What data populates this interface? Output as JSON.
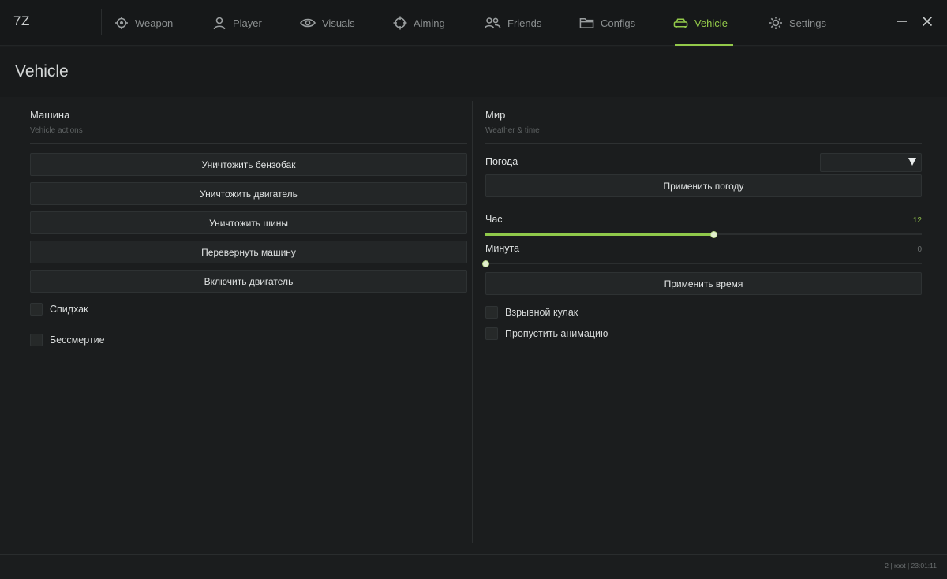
{
  "app": {
    "logo": "7Z"
  },
  "nav": {
    "tabs": [
      {
        "label": "Weapon",
        "icon": "crosshair-dot-icon"
      },
      {
        "label": "Player",
        "icon": "user-icon"
      },
      {
        "label": "Visuals",
        "icon": "eye-icon"
      },
      {
        "label": "Aiming",
        "icon": "target-icon"
      },
      {
        "label": "Friends",
        "icon": "users-icon"
      },
      {
        "label": "Configs",
        "icon": "folder-icon"
      },
      {
        "label": "Vehicle",
        "icon": "car-icon",
        "active": true
      },
      {
        "label": "Settings",
        "icon": "sun-gear-icon"
      }
    ],
    "accent_color": "#93c94a"
  },
  "page": {
    "title": "Vehicle"
  },
  "left_panel": {
    "title": "Машина",
    "subtitle": "Vehicle actions",
    "buttons": [
      "Уничтожить бензобак",
      "Уничтожить двигатель",
      "Уничтожить шины",
      "Перевернуть машину",
      "Включить двигатель"
    ],
    "checkboxes": [
      {
        "label": "Спидхак",
        "checked": false
      },
      {
        "label": "Бессмертие",
        "checked": false
      }
    ]
  },
  "right_panel": {
    "title": "Мир",
    "subtitle": "Weather & time",
    "weather": {
      "label": "Погода",
      "selected": ""
    },
    "apply_weather_label": "Применить погоду",
    "hour": {
      "label": "Час",
      "value": "12",
      "fraction": 0.522
    },
    "minute": {
      "label": "Минута",
      "value": "0",
      "fraction": 0.0
    },
    "apply_time_label": "Применить время",
    "checkboxes": [
      {
        "label": "Взрывной кулак",
        "checked": false
      },
      {
        "label": "Пропустить анимацию",
        "checked": false
      }
    ]
  },
  "footer": {
    "status": "2 | root | 23:01:11"
  }
}
